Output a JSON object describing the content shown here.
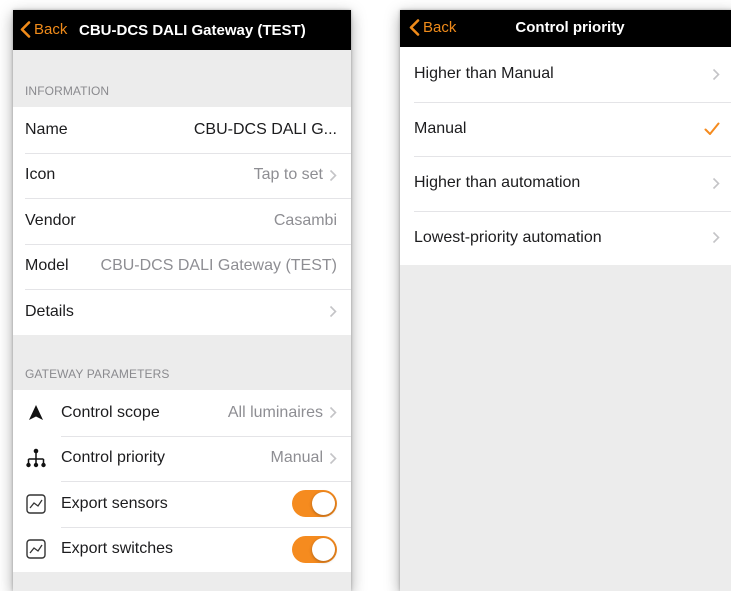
{
  "left": {
    "nav": {
      "back_label": "Back",
      "title": "CBU-DCS DALI Gateway (TEST)"
    },
    "information": {
      "header": "INFORMATION",
      "rows": [
        {
          "label": "Name",
          "value": "CBU-DCS DALI G..."
        },
        {
          "label": "Icon",
          "value": "Tap to set"
        },
        {
          "label": "Vendor",
          "value": "Casambi"
        },
        {
          "label": "Model",
          "value": "CBU-DCS DALI Gateway (TEST)"
        },
        {
          "label": "Details",
          "value": ""
        }
      ]
    },
    "gateway": {
      "header": "GATEWAY PARAMETERS",
      "rows": [
        {
          "label": "Control scope",
          "value": "All luminaires",
          "icon": "triangle-icon"
        },
        {
          "label": "Control priority",
          "value": "Manual",
          "icon": "hierarchy-icon"
        },
        {
          "label": "Export sensors",
          "toggle": true,
          "icon": "chart-icon"
        },
        {
          "label": "Export switches",
          "toggle": true,
          "icon": "chart-icon"
        }
      ]
    }
  },
  "right": {
    "nav": {
      "back_label": "Back",
      "title": "Control priority"
    },
    "options": [
      {
        "label": "Higher than Manual",
        "selected": false
      },
      {
        "label": "Manual",
        "selected": true
      },
      {
        "label": "Higher than automation",
        "selected": false
      },
      {
        "label": "Lowest-priority automation",
        "selected": false
      }
    ]
  },
  "colors": {
    "accent": "#f58b1f",
    "navbar": "#000000",
    "background": "#ececec"
  }
}
